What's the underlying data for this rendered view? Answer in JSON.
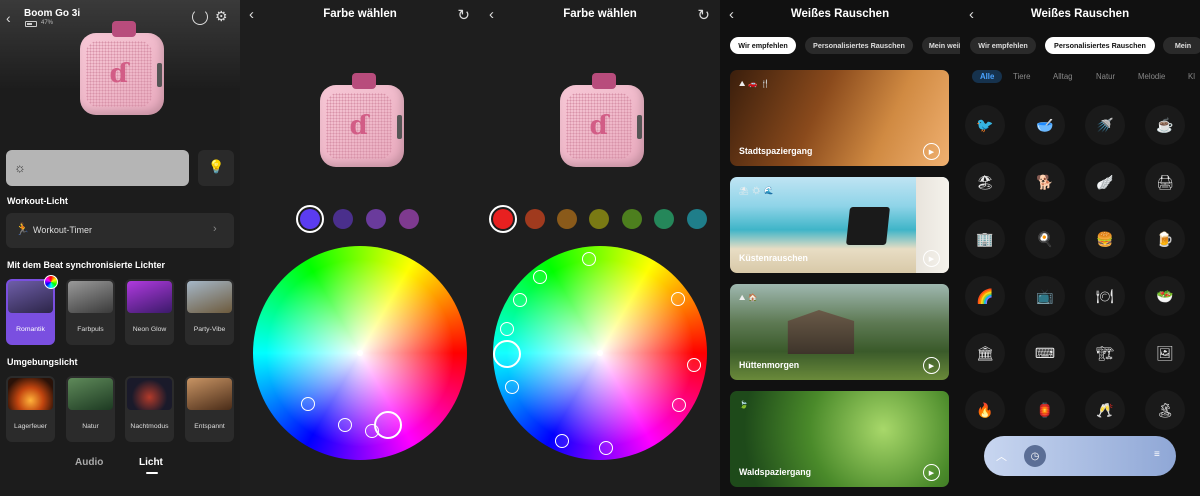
{
  "panel1": {
    "device_name": "Boom Go 3i",
    "battery": "47%",
    "workout_section": "Workout-Licht",
    "workout_timer": "Workout-Timer",
    "beat_section": "Mit dem Beat synchronisierte Lichter",
    "beat_tiles": [
      "Romantik",
      "Farbpuls",
      "Neon Glow",
      "Party-Vibe"
    ],
    "ambient_section": "Umgebungslicht",
    "ambient_tiles": [
      "Lagerfeuer",
      "Natur",
      "Nachtmodus",
      "Entspannt"
    ],
    "tabs": [
      "Audio",
      "Licht"
    ],
    "active_tab": "Licht",
    "icons": [
      "back-icon",
      "power-icon",
      "gear-icon",
      "sun-icon",
      "bulb-icon",
      "runner-icon",
      "chevron-right-icon"
    ]
  },
  "panel2": {
    "title": "Farbe wählen",
    "swatches": [
      "#5b3cf0",
      "#4a2f8c",
      "#6a3b9c",
      "#7e3a8f"
    ],
    "selected_swatch": "#5b3cf0"
  },
  "panel3": {
    "title": "Farbe wählen",
    "swatches": [
      "#e82020",
      "#a03a1e",
      "#8a5a1a",
      "#7a7a14",
      "#4d7f1e",
      "#25875a",
      "#1f7e8a"
    ],
    "selected_swatch": "#e82020"
  },
  "panel4": {
    "title": "Weißes Rauschen",
    "tabs": [
      "Wir empfehlen",
      "Personalisiertes Rauschen",
      "Mein weiß"
    ],
    "active_tab": "Wir empfehlen",
    "cards": [
      "Stadtspaziergang",
      "Küstenrauschen",
      "Hüttenmorgen",
      "Waldspaziergang"
    ]
  },
  "panel5": {
    "title": "Weißes Rauschen",
    "tabs": [
      "Wir empfehlen",
      "Personalisiertes Rauschen",
      "Mein"
    ],
    "active_tab": "Personalisiertes Rauschen",
    "categories": [
      "Alle",
      "Tiere",
      "Alltag",
      "Natur",
      "Melodie",
      "Kl"
    ],
    "active_category": "Alle",
    "sound_icons": [
      "🐦",
      "🥣",
      "🚿",
      "☕",
      "🏖",
      "🐕",
      "🪽",
      "🖨",
      "🏢",
      "🍳",
      "🍔",
      "🍺",
      "🌈",
      "📺",
      "🍽",
      "🥗",
      "🏛",
      "⌨",
      "🏗",
      "🖼",
      "🔥",
      "🏮",
      "🥂",
      "🏝"
    ]
  },
  "colors": {
    "accent_purple": "#7a4fe0",
    "panel_bg": "#1c1c1c",
    "card_bg": "#2b2b2b",
    "pill_active": "#ffffff",
    "category_active": "#4aa3ff"
  }
}
